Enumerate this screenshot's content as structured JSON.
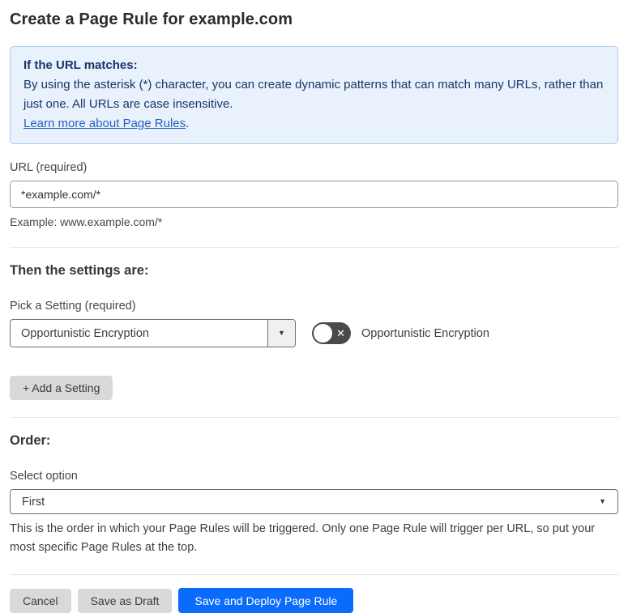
{
  "page": {
    "title": "Create a Page Rule for example.com"
  },
  "info_box": {
    "heading": "If the URL matches:",
    "body": "By using the asterisk (*) character, you can create dynamic patterns that can match many URLs, rather than just one. All URLs are case insensitive.",
    "link_label": "Learn more about Page Rules",
    "link_suffix": "."
  },
  "url_section": {
    "label": "URL (required)",
    "input_value": "*example.com/*",
    "example": "Example: www.example.com/*"
  },
  "settings_section": {
    "heading": "Then the settings are:",
    "pick_label": "Pick a Setting (required)",
    "selected_setting": "Opportunistic Encryption",
    "dropdown_caret": "▼",
    "toggle_label": "Opportunistic Encryption",
    "toggle_state": "off",
    "toggle_glyph": "✕",
    "add_button_label": "+ Add a Setting"
  },
  "order_section": {
    "heading": "Order:",
    "select_label": "Select option",
    "selected_option": "First",
    "select_caret": "▼",
    "help_text": "This is the order in which your Page Rules will be triggered. Only one Page Rule will trigger per URL, so put your most specific Page Rules at the top."
  },
  "footer": {
    "cancel_label": "Cancel",
    "save_draft_label": "Save as Draft",
    "save_deploy_label": "Save and Deploy Page Rule"
  },
  "colors": {
    "info_bg": "#e9f2fc",
    "info_border": "#a9c9ee",
    "info_text": "#17356b",
    "link": "#2161c4",
    "primary_button": "#0b6cfb",
    "toggle_off": "#4a4a4a",
    "gray_button": "#d9d9d9"
  }
}
